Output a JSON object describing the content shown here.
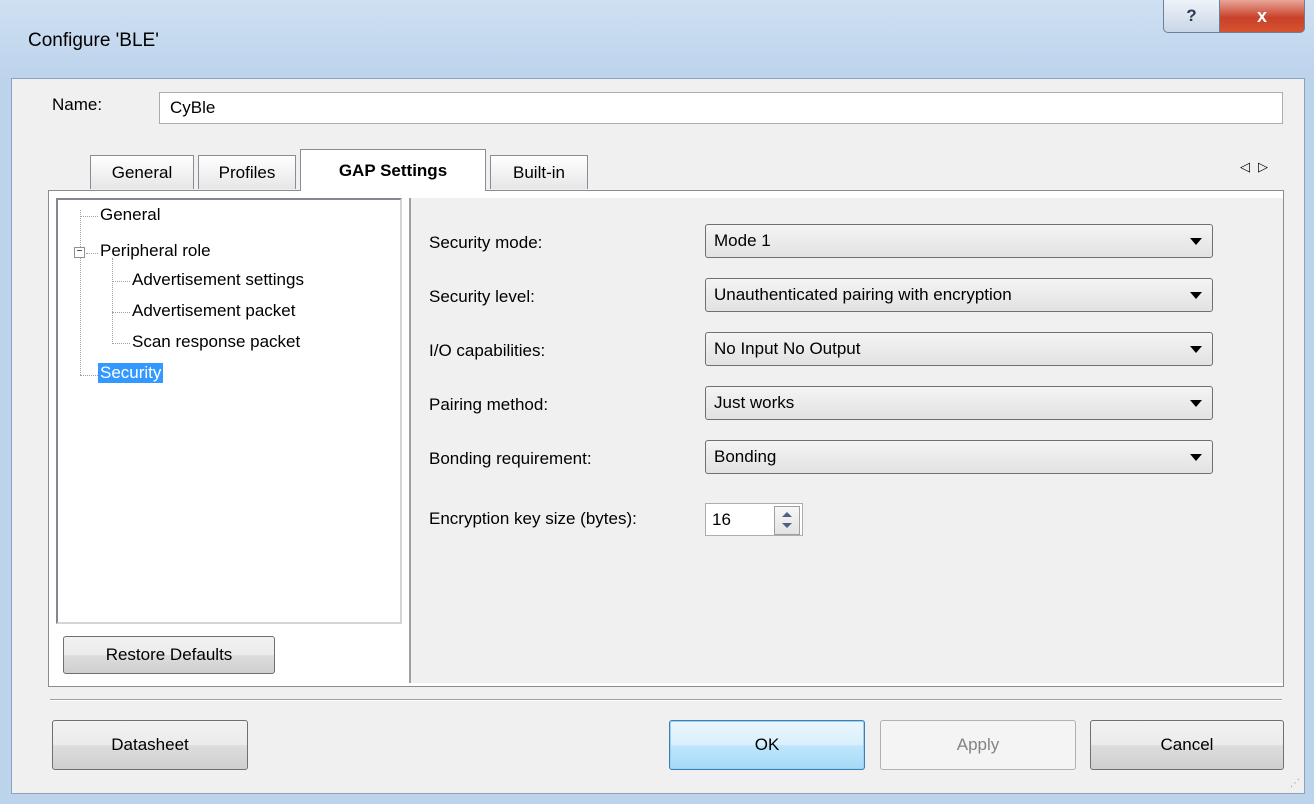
{
  "window": {
    "title": "Configure 'BLE'",
    "help_label": "?",
    "close_label": "x"
  },
  "name_field": {
    "label": "Name:",
    "value": "CyBle"
  },
  "tabs": [
    {
      "label": "General",
      "active": false
    },
    {
      "label": "Profiles",
      "active": false
    },
    {
      "label": "GAP Settings",
      "active": true
    },
    {
      "label": "Built-in",
      "active": false
    }
  ],
  "tab_scroll": {
    "left": "◁",
    "right": "▷"
  },
  "tree": {
    "items": [
      {
        "label": "General"
      },
      {
        "label": "Peripheral role",
        "expander": "−"
      },
      {
        "label": "Advertisement settings"
      },
      {
        "label": "Advertisement packet"
      },
      {
        "label": "Scan response packet"
      },
      {
        "label": "Security",
        "selected": true
      }
    ]
  },
  "restore_defaults_label": "Restore Defaults",
  "settings": {
    "security_mode": {
      "label": "Security mode:",
      "value": "Mode 1"
    },
    "security_level": {
      "label": "Security level:",
      "value": "Unauthenticated pairing with encryption"
    },
    "io_capabilities": {
      "label": "I/O capabilities:",
      "value": "No Input No Output"
    },
    "pairing_method": {
      "label": "Pairing method:",
      "value": "Just works"
    },
    "bonding_requirement": {
      "label": "Bonding requirement:",
      "value": "Bonding"
    },
    "encryption_key_size": {
      "label": "Encryption key size (bytes):",
      "value": "16"
    }
  },
  "buttons": {
    "datasheet": "Datasheet",
    "ok": "OK",
    "apply": "Apply",
    "cancel": "Cancel"
  },
  "colors": {
    "selection": "#3399ff",
    "frame": "#bcd3ec",
    "close": "#c9412a"
  }
}
